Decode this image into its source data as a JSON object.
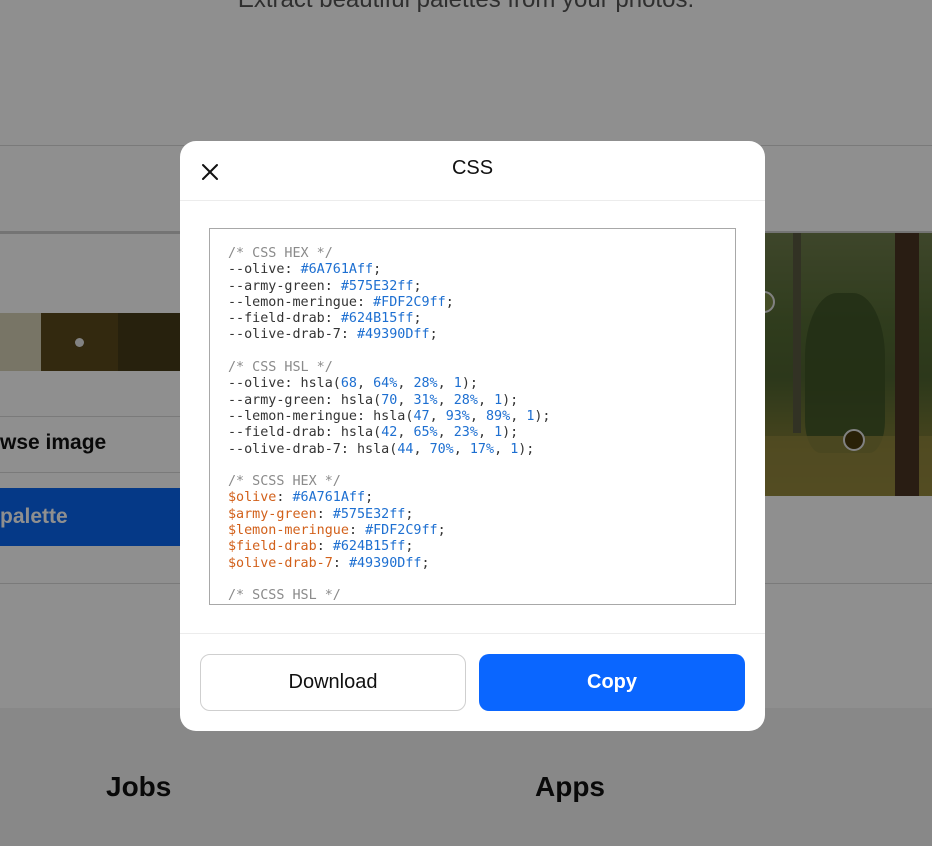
{
  "background": {
    "subtitle": "Extract beautiful palettes from your photos.",
    "browse_label": "wse image",
    "generate_label": "palette",
    "swatches": [
      {
        "color": "#d7d0b6",
        "width": 41
      },
      {
        "color": "#5b4a1c",
        "width": 77
      },
      {
        "color": "#463b18",
        "width": 62
      }
    ],
    "footer": {
      "jobs": "Jobs",
      "apps": "Apps"
    }
  },
  "modal": {
    "title": "CSS",
    "close_icon": "close-icon",
    "sections": [
      {
        "comment": "/* CSS HEX */",
        "kind": "css",
        "lines": [
          {
            "name": "--olive",
            "value": "#6A761Aff"
          },
          {
            "name": "--army-green",
            "value": "#575E32ff"
          },
          {
            "name": "--lemon-meringue",
            "value": "#FDF2C9ff"
          },
          {
            "name": "--field-drab",
            "value": "#624B15ff"
          },
          {
            "name": "--olive-drab-7",
            "value": "#49390Dff"
          }
        ]
      },
      {
        "comment": "/* CSS HSL */",
        "kind": "hsl",
        "lines": [
          {
            "name": "--olive",
            "h": "68",
            "s": "64%",
            "l": "28%",
            "a": "1"
          },
          {
            "name": "--army-green",
            "h": "70",
            "s": "31%",
            "l": "28%",
            "a": "1"
          },
          {
            "name": "--lemon-meringue",
            "h": "47",
            "s": "93%",
            "l": "89%",
            "a": "1"
          },
          {
            "name": "--field-drab",
            "h": "42",
            "s": "65%",
            "l": "23%",
            "a": "1"
          },
          {
            "name": "--olive-drab-7",
            "h": "44",
            "s": "70%",
            "l": "17%",
            "a": "1"
          }
        ]
      },
      {
        "comment": "/* SCSS HEX */",
        "kind": "scss",
        "lines": [
          {
            "name": "$olive",
            "value": "#6A761Aff"
          },
          {
            "name": "$army-green",
            "value": "#575E32ff"
          },
          {
            "name": "$lemon-meringue",
            "value": "#FDF2C9ff"
          },
          {
            "name": "$field-drab",
            "value": "#624B15ff"
          },
          {
            "name": "$olive-drab-7",
            "value": "#49390Dff"
          }
        ]
      },
      {
        "comment": "/* SCSS HSL */",
        "kind": "scss",
        "lines": []
      }
    ],
    "download_label": "Download",
    "copy_label": "Copy"
  },
  "colors": {
    "accent": "#0a66ff",
    "comment": "#8a8a8a",
    "number": "#1d6fd1",
    "sass_variable": "#d2601a"
  }
}
